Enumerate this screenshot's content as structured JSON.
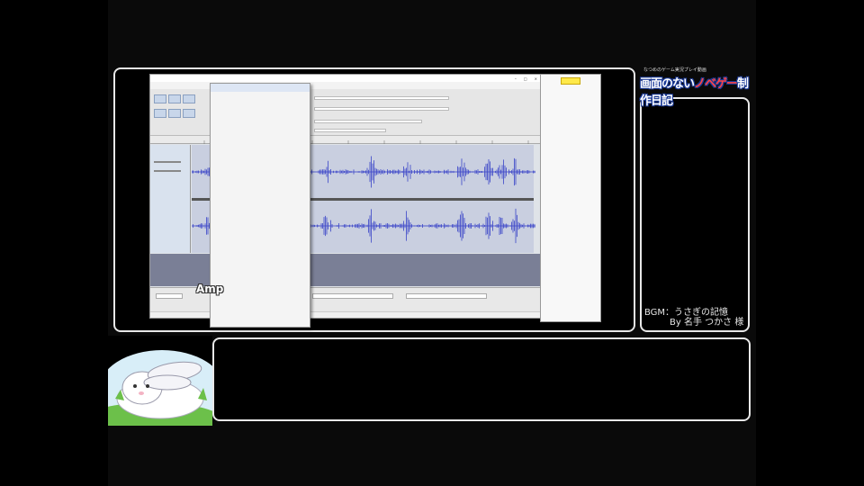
{
  "overlay": {
    "logo_small": "なつめのゲーム実況プレイ動画",
    "logo_main_part1": "画面のない",
    "logo_main_red": "ノベゲー",
    "logo_main_part2": "制作日記",
    "credit_line1": "BGM：うさぎの記憶",
    "credit_line2": "By 名手 つかさ 様",
    "amp_label": "Amp"
  },
  "app": {
    "title": "",
    "menubar": [
      "",
      "",
      "",
      "",
      "",
      "",
      "",
      ""
    ],
    "status": ""
  },
  "menu": {
    "items": [
      {
        "label": "",
        "shortcut": ""
      },
      {
        "label": "",
        "shortcut": ""
      },
      {
        "label": "",
        "shortcut": ""
      },
      {
        "label": "",
        "shortcut": ""
      },
      {
        "label": "",
        "shortcut": ""
      },
      {
        "label": "",
        "shortcut": ""
      },
      {
        "label": "",
        "shortcut": ""
      },
      {
        "label": "",
        "shortcut": ""
      },
      {
        "label": "",
        "shortcut": ""
      },
      {
        "label": "",
        "shortcut": ""
      },
      {
        "label": "",
        "shortcut": ""
      },
      {
        "label": "",
        "shortcut": ""
      },
      {
        "label": "",
        "shortcut": ""
      },
      {
        "label": "",
        "shortcut": ""
      },
      {
        "label": "",
        "shortcut": ""
      },
      {
        "label": "",
        "shortcut": ""
      },
      {
        "label": "",
        "shortcut": ""
      },
      {
        "label": "",
        "shortcut": ""
      },
      {
        "label": "",
        "shortcut": ""
      },
      {
        "label": "",
        "shortcut": ""
      },
      {
        "label": "",
        "shortcut": ""
      },
      {
        "label": "",
        "shortcut": ""
      },
      {
        "label": "",
        "shortcut": ""
      },
      {
        "label": "",
        "shortcut": ""
      },
      {
        "label": "",
        "shortcut": ""
      },
      {
        "label": "",
        "shortcut": ""
      },
      {
        "label": "",
        "shortcut": ""
      },
      {
        "label": "",
        "shortcut": ""
      },
      {
        "label": "",
        "shortcut": ""
      },
      {
        "label": "",
        "shortcut": ""
      }
    ]
  },
  "panel": {
    "rows": [
      "",
      "",
      "",
      "",
      "",
      "",
      ""
    ]
  },
  "message_box": {
    "text": ""
  },
  "colors": {
    "waveform": "#3a45c8",
    "frame_border": "#e8e8e8",
    "logo_accent": "#ff4444",
    "panel_highlight": "#ffe94a"
  }
}
